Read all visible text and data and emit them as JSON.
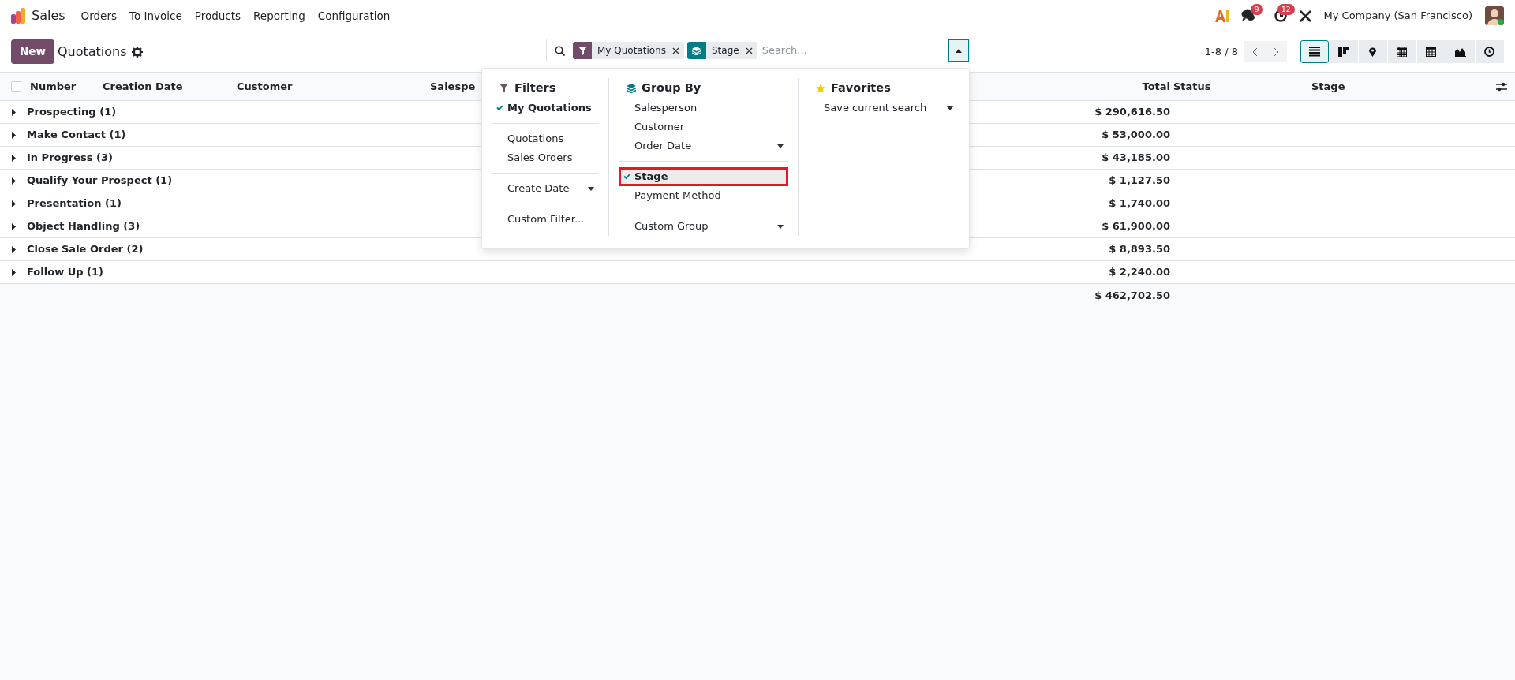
{
  "navbar": {
    "app_name": "Sales",
    "menu": [
      "Orders",
      "To Invoice",
      "Products",
      "Reporting",
      "Configuration"
    ],
    "messages_badge": "9",
    "activities_badge": "12",
    "company": "My Company (San Francisco)"
  },
  "control_panel": {
    "new_button": "New",
    "title": "Quotations",
    "facets": [
      {
        "kind": "filter",
        "label": "My Quotations"
      },
      {
        "kind": "group",
        "label": "Stage"
      }
    ],
    "search_placeholder": "Search...",
    "dropdown_open": true,
    "pager": "1-8 / 8",
    "views": [
      {
        "kind": "list",
        "selected": true
      },
      {
        "kind": "kanban",
        "selected": false
      },
      {
        "kind": "map",
        "selected": false
      },
      {
        "kind": "calendar",
        "selected": false
      },
      {
        "kind": "pivot",
        "selected": false
      },
      {
        "kind": "graph",
        "selected": false
      },
      {
        "kind": "activity",
        "selected": false
      }
    ]
  },
  "table": {
    "select_all_checked": false,
    "columns": [
      "Number",
      "Creation Date",
      "Customer",
      "Salespe",
      "Total",
      "Status",
      "Stage"
    ],
    "groups": [
      {
        "label": "Prospecting (1)",
        "total": "$ 290,616.50",
        "expanded": false
      },
      {
        "label": "Make Contact (1)",
        "total": "$ 53,000.00",
        "expanded": false
      },
      {
        "label": "In Progress (3)",
        "total": "$ 43,185.00",
        "expanded": false
      },
      {
        "label": "Qualify Your Prospect (1)",
        "total": "$ 1,127.50",
        "expanded": false
      },
      {
        "label": "Presentation (1)",
        "total": "$ 1,740.00",
        "expanded": false
      },
      {
        "label": "Object Handling (3)",
        "total": "$ 61,900.00",
        "expanded": false
      },
      {
        "label": "Close Sale Order (2)",
        "total": "$ 8,893.50",
        "expanded": false
      },
      {
        "label": "Follow Up (1)",
        "total": "$ 2,240.00",
        "expanded": false
      }
    ],
    "grand_total": "$ 462,702.50"
  },
  "search_panel": {
    "columns": [
      {
        "kind": "filters",
        "title": "Filters",
        "sections": [
          [
            {
              "label": "My Quotations",
              "checked": true,
              "submenu": false,
              "highlighted": false
            }
          ],
          [
            {
              "label": "Quotations",
              "checked": false,
              "submenu": false,
              "highlighted": false
            },
            {
              "label": "Sales Orders",
              "checked": false,
              "submenu": false,
              "highlighted": false
            }
          ],
          [
            {
              "label": "Create Date",
              "checked": false,
              "submenu": true,
              "highlighted": false
            }
          ],
          [
            {
              "label": "Custom Filter...",
              "checked": false,
              "submenu": false,
              "highlighted": false
            }
          ]
        ]
      },
      {
        "kind": "groupby",
        "title": "Group By",
        "sections": [
          [
            {
              "label": "Salesperson",
              "checked": false,
              "submenu": false,
              "highlighted": false
            },
            {
              "label": "Customer",
              "checked": false,
              "submenu": false,
              "highlighted": false
            },
            {
              "label": "Order Date",
              "checked": false,
              "submenu": true,
              "highlighted": false
            }
          ],
          [
            {
              "label": "Stage",
              "checked": true,
              "submenu": false,
              "highlighted": true
            },
            {
              "label": "Payment Method",
              "checked": false,
              "submenu": false,
              "highlighted": false
            }
          ],
          [
            {
              "label": "Custom Group",
              "checked": false,
              "submenu": true,
              "highlighted": false
            }
          ]
        ]
      },
      {
        "kind": "favorites",
        "title": "Favorites",
        "sections": [
          [
            {
              "label": "Save current search",
              "checked": false,
              "submenu": true,
              "highlighted": false
            }
          ]
        ]
      }
    ]
  }
}
